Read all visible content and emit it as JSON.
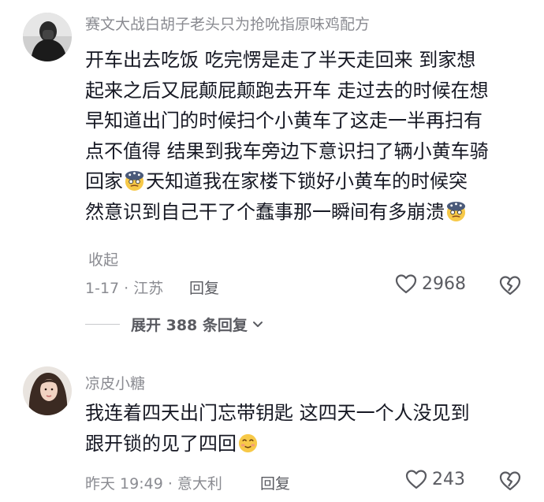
{
  "comments": [
    {
      "username": "赛文大战白胡子老头只为抢吮指原味鸡配方",
      "lines": [
        "开车出去吃饭 吃完愣是走了半天走回来 到家想",
        "起来之后又屁颠屁颠跑去开车 走过去的时候在想",
        "早知道出门的时候扫个小黄车了这走一半再扫有",
        "点不值得 结果到我车旁边下意识扫了辆小黄车骑",
        "回家",
        "天知道我在家楼下锁好小黄车的时候突",
        "然意识到自己干了个蠢事那一瞬间有多崩溃"
      ],
      "collapse_label": "收起",
      "date_location": "1-17 · 江苏",
      "reply_label": "回复",
      "likes": "2968",
      "expand_replies_label": "展开 388 条回复"
    },
    {
      "username": "凉皮小糖",
      "lines": [
        "我连着四天出门忘带钥匙 这四天一个人没见到",
        "跟开锁的见了四回"
      ],
      "date_location": "昨天 19:49 · 意大利",
      "reply_label": "回复",
      "likes": "243"
    }
  ],
  "icons": {
    "like": "heart-outline-icon",
    "dislike": "broken-heart-icon",
    "expand": "chevron-down-icon",
    "emoji_1": "dizzy-face-emoji",
    "emoji_2": "smiling-face-emoji"
  }
}
